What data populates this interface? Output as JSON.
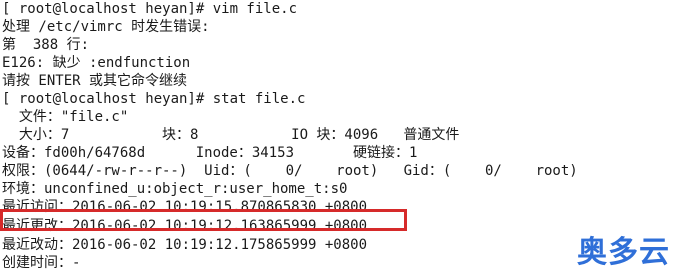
{
  "terminal": {
    "lines": [
      "[ root@localhost heyan]# vim file.c",
      "处理 /etc/vimrc 时发生错误:",
      "第  388 行:",
      "E126: 缺少 :endfunction",
      "请按 ENTER 或其它命令继续",
      "[ root@localhost heyan]# stat file.c",
      "  文件：\"file.c\"",
      "  大小：7           块：8           IO 块：4096   普通文件",
      "设备：fd00h/64768d      Inode：34153       硬链接：1",
      "权限：(0644/-rw-r--r--)  Uid：(    0/    root)   Gid：(    0/    root)",
      "环境：unconfined_u:object_r:user_home_t:s0",
      "最近访问：2016-06-02 10:19:15.870865830 +0800",
      "最近更改：2016-06-02 10:19:12.163865999 +0800",
      "最近改动：2016-06-02 10:19:12.175865999 +0800",
      "创建时间：-"
    ]
  },
  "watermark": {
    "text": "奥多云"
  },
  "colors": {
    "highlight": "#d62a2a",
    "watermark": "#2f6fd8"
  }
}
